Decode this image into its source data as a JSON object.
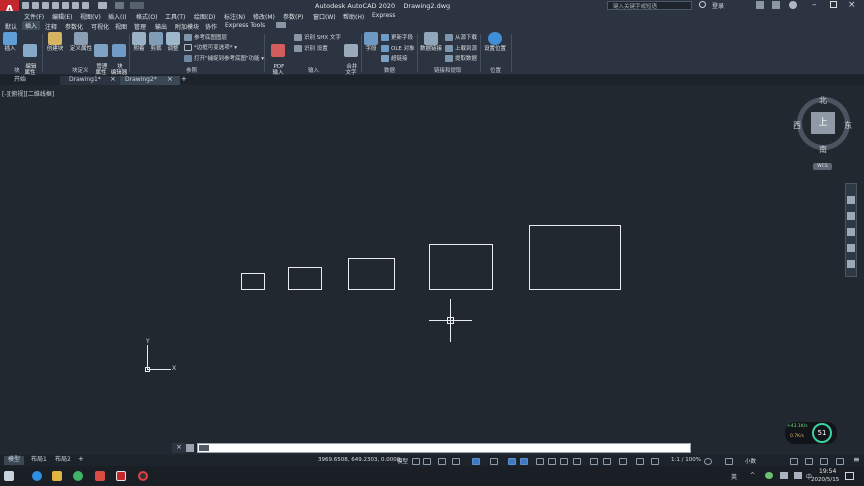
{
  "title": "Autodesk AutoCAD 2020    Drawing2.dwg",
  "search_placeholder": "键入关键字或短语",
  "login": "登录",
  "menu": [
    "文件(F)",
    "编辑(E)",
    "视图(V)",
    "插入(I)",
    "格式(O)",
    "工具(T)",
    "绘图(D)",
    "标注(N)",
    "修改(M)",
    "参数(P)",
    "窗口(W)",
    "帮助(H)",
    "Express"
  ],
  "ribbon_tabs": [
    "默认",
    "插入",
    "注释",
    "参数化",
    "可视化",
    "视图",
    "管理",
    "输出",
    "附加模块",
    "协作",
    "Express Tools"
  ],
  "ribbon": {
    "insert": "插入",
    "edit_attr": "编辑\n属性",
    "create_block": "创建块",
    "define_attr": "定义属性",
    "manage_attr": "管理\n属性",
    "block_editor": "块\n编辑器",
    "attach": "附着",
    "clip": "剪裁",
    "adjust": "调整",
    "ref_underlay": "参考底图图层",
    "frames_vary": "*边框可变选项*",
    "snap_underlay": "打开\"捕捉到参考底图\"功能",
    "pdf_import": "PDF\n输入",
    "recognize_shx": "识别 SHX 文字",
    "recognize_settings": "识别 设置",
    "merge_text": "合并\n文字",
    "field": "字段",
    "update_fields": "更新字段",
    "ole_object": "OLE 对象",
    "hyperlink": "超链接",
    "data_link": "数据链接",
    "download_source": "从源下载",
    "upload_source": "上载到源",
    "extract_data": "提取数据",
    "set_location": "设置位置",
    "panel_block": "块",
    "panel_block_def": "块定义",
    "panel_reference": "参照",
    "panel_import": "输入",
    "panel_data": "数据",
    "panel_linking": "链接和提取",
    "panel_location": "位置"
  },
  "doc_tabs": [
    "开始",
    "Drawing1*",
    "Drawing2*"
  ],
  "viewport_label": "[-][俯视][二维线框]",
  "viewcube": {
    "north": "北",
    "south": "南",
    "east": "东",
    "west": "西",
    "top": "上",
    "wcs": "WCS"
  },
  "ucs": {
    "x": "X",
    "y": "Y"
  },
  "nav": {
    "sw": "+43.1K/s",
    "sw2": "0.7K/s",
    "pct": "51"
  },
  "command_placeholder": "",
  "layout_tabs": [
    "模型",
    "布局1",
    "布局2"
  ],
  "status": {
    "coords": "3969.6508, 649.2303, 0.0000",
    "model": "模型",
    "scale": "1:1 / 100%",
    "units": "小数"
  },
  "taskbar": {
    "time": "19:54",
    "date": "2020/5/15",
    "lang": "英"
  }
}
